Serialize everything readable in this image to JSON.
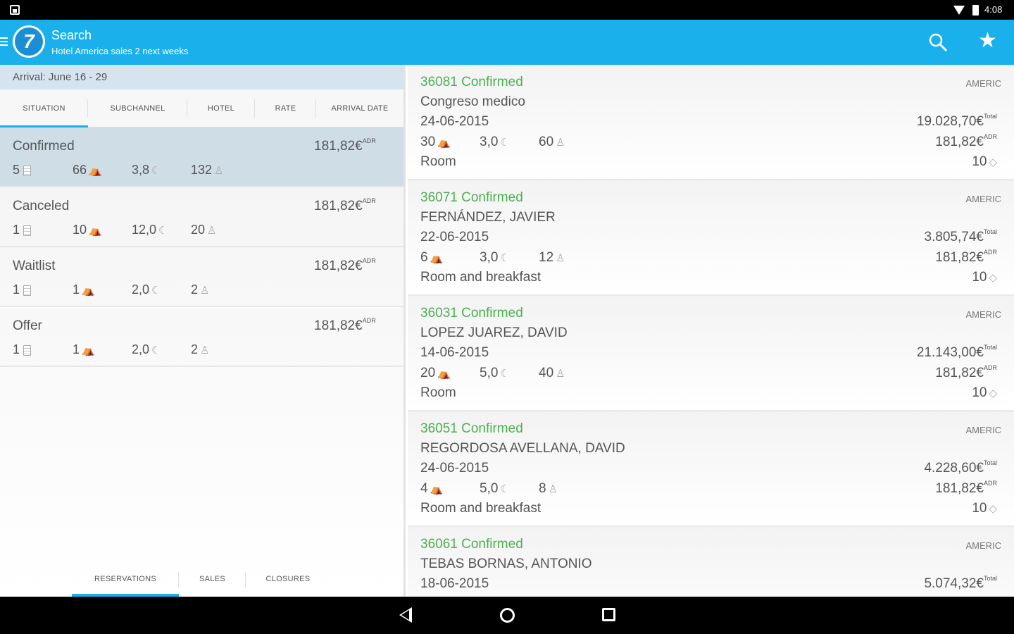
{
  "status_bar": {
    "time": "4:08"
  },
  "app_bar": {
    "title": "Search",
    "subtitle": "Hotel America sales 2 next weeks",
    "logo_text": "7",
    "brand_color": "#1ab0ec"
  },
  "left_panel": {
    "arrival_label": "Arrival: June 16 - 29",
    "tabs": [
      {
        "label": "SITUATION",
        "active": true
      },
      {
        "label": "SUBCHANNEL",
        "active": false
      },
      {
        "label": "HOTEL",
        "active": false
      },
      {
        "label": "RATE",
        "active": false
      },
      {
        "label": "ARRIVAL DATE",
        "active": false
      }
    ],
    "statuses": [
      {
        "name": "Confirmed",
        "adr": "181,82€",
        "adr_sup": "ADR",
        "count": "5",
        "guests": "66",
        "nights": "3,8",
        "people": "132",
        "selected": true
      },
      {
        "name": "Canceled",
        "adr": "181,82€",
        "adr_sup": "ADR",
        "count": "1",
        "guests": "10",
        "nights": "12,0",
        "people": "20",
        "selected": false
      },
      {
        "name": "Waitlist",
        "adr": "181,82€",
        "adr_sup": "ADR",
        "count": "1",
        "guests": "1",
        "nights": "2,0",
        "people": "2",
        "selected": false
      },
      {
        "name": "Offer",
        "adr": "181,82€",
        "adr_sup": "ADR",
        "count": "1",
        "guests": "1",
        "nights": "2,0",
        "people": "2",
        "selected": false
      }
    ],
    "bottom_tabs": [
      {
        "label": "RESERVATIONS",
        "active": true
      },
      {
        "label": "SALES",
        "active": false
      },
      {
        "label": "CLOSURES",
        "active": false
      }
    ]
  },
  "reservations": [
    {
      "id_label": "36081 Confirmed",
      "hotel": "AMERIC",
      "name": "Congreso medico",
      "date": "24-06-2015",
      "rooms": "30",
      "nights": "3,0",
      "people": "60",
      "board": "Room",
      "total": "19.028,70€",
      "total_sup": "Total",
      "adr": "181,82€",
      "adr_sup": "ADR",
      "tag": "10"
    },
    {
      "id_label": "36071 Confirmed",
      "hotel": "AMERIC",
      "name": "FERNÁNDEZ, JAVIER",
      "date": "22-06-2015",
      "rooms": "6",
      "nights": "3,0",
      "people": "12",
      "board": "Room and breakfast",
      "total": "3.805,74€",
      "total_sup": "Total",
      "adr": "181,82€",
      "adr_sup": "ADR",
      "tag": "10"
    },
    {
      "id_label": "36031 Confirmed",
      "hotel": "AMERIC",
      "name": "LOPEZ JUAREZ, DAVID",
      "date": "14-06-2015",
      "rooms": "20",
      "nights": "5,0",
      "people": "40",
      "board": "Room",
      "total": "21.143,00€",
      "total_sup": "Total",
      "adr": "181,82€",
      "adr_sup": "ADR",
      "tag": "10"
    },
    {
      "id_label": "36051 Confirmed",
      "hotel": "AMERIC",
      "name": "REGORDOSA AVELLANA, DAVID",
      "date": "24-06-2015",
      "rooms": "4",
      "nights": "5,0",
      "people": "8",
      "board": "Room and breakfast",
      "total": "4.228,60€",
      "total_sup": "Total",
      "adr": "181,82€",
      "adr_sup": "ADR",
      "tag": "10"
    },
    {
      "id_label": "36061 Confirmed",
      "hotel": "AMERIC",
      "name": "TEBAS BORNAS, ANTONIO",
      "date": "18-06-2015",
      "rooms": "",
      "nights": "",
      "people": "",
      "board": "",
      "total": "5.074,32€",
      "total_sup": "Total",
      "adr": "",
      "adr_sup": "",
      "tag": ""
    }
  ]
}
